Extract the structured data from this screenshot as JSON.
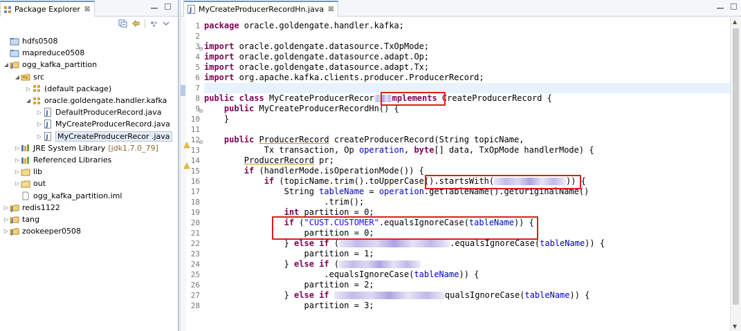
{
  "explorer": {
    "title": "Package Explorer",
    "close_glyph": "⊠",
    "tree": [
      {
        "label": "hdfs0508",
        "icon": "project-folder-icon",
        "level": 0,
        "twisty": ""
      },
      {
        "label": "mapreduce0508",
        "icon": "project-folder-icon",
        "level": 0,
        "twisty": ""
      },
      {
        "label": "ogg_kafka_partition",
        "icon": "java-project-icon",
        "level": 0,
        "twisty": "expanded"
      },
      {
        "label": "src",
        "icon": "source-folder-icon",
        "level": 1,
        "twisty": "expanded"
      },
      {
        "label": "(default package)",
        "icon": "package-icon",
        "level": 2,
        "twisty": "collapsed"
      },
      {
        "label": "oracle.goldengate.handler.kafka",
        "icon": "package-icon",
        "level": 2,
        "twisty": "expanded"
      },
      {
        "label": "DefaultProducerRecord.java",
        "icon": "java-file-icon",
        "level": 3,
        "twisty": "collapsed"
      },
      {
        "label": "MyCreateProducerRecord.java",
        "icon": "java-file-icon",
        "level": 3,
        "twisty": "collapsed"
      },
      {
        "label": "MyCreateProducerRecor    .java",
        "icon": "java-file-icon",
        "level": 3,
        "twisty": "collapsed",
        "selected": true
      },
      {
        "label": "JRE System Library",
        "version": "[jdk1.7.0_79]",
        "icon": "library-icon",
        "level": 1,
        "twisty": "collapsed"
      },
      {
        "label": "Referenced Libraries",
        "icon": "library-icon",
        "level": 1,
        "twisty": "collapsed"
      },
      {
        "label": "lib",
        "icon": "folder-icon",
        "level": 1,
        "twisty": "collapsed"
      },
      {
        "label": "out",
        "icon": "folder-icon",
        "level": 1,
        "twisty": "collapsed"
      },
      {
        "label": "ogg_kafka_partition.iml",
        "icon": "file-icon",
        "level": 1,
        "twisty": ""
      },
      {
        "label": "redis1122",
        "icon": "java-project-icon",
        "level": 0,
        "twisty": "collapsed"
      },
      {
        "label": "tang",
        "icon": "java-project-icon",
        "level": 0,
        "twisty": "collapsed"
      },
      {
        "label": "zookeeper0508",
        "icon": "java-project-icon",
        "level": 0,
        "twisty": "collapsed"
      }
    ]
  },
  "editor": {
    "tab_label": "MyCreateProducerRecordHn.java",
    "close_glyph": "⊠",
    "line_numbers": [
      "1",
      "2",
      "3",
      "4",
      "5",
      "6",
      "7",
      "8",
      "9",
      "10",
      "11",
      "12",
      "13",
      "14",
      "15",
      "16",
      "17",
      "18",
      "19",
      "20",
      "21",
      "22",
      "23",
      "24",
      "25",
      "26",
      "27",
      "28"
    ],
    "code": {
      "l1_kw": "package",
      "l1_rest": " oracle.goldengate.handler.kafka;",
      "l3_kw": "import",
      "l3_rest": " oracle.goldengate.datasource.TxOpMode;",
      "l4_kw": "import",
      "l4_rest": " oracle.goldengate.datasource.adapt.Op;",
      "l5_kw": "import",
      "l5_rest": " oracle.goldengate.datasource.adapt.Tx;",
      "l6_kw": "import",
      "l6_rest": " org.apache.kafka.clients.producer.ProducerRecord;",
      "l8_kw1": "public",
      "l8_kw2": "class",
      "l8_name": " MyCreateProducerRecor",
      "l8_impl": "mplements",
      "l8_tail": " CreateProducerRecord {",
      "l9_kw": "public",
      "l9_rest": " MyCreateProducerRecordHn() {",
      "l10": "    }",
      "l12_kw": "public",
      "l12_type": "ProducerRecord",
      "l12_rest": " createProducerRecord(String topicName,",
      "l13_a": "            Tx transaction, Op ",
      "l13_op": "operation",
      "l13_b": ", ",
      "l13_byte": "byte",
      "l13_c": "[] data, TxOpMode handlerMode) {",
      "l14_type": "ProducerRecord",
      "l14_rest": " pr;",
      "l15_kw": "if",
      "l15_rest": " (handlerMode.isOperationMode()) {",
      "l16_kw": "if",
      "l16_rest": " (topicName.trim().toUpperCase()",
      "l16_sw": ".startsWith(",
      "l16_tail": ")) {",
      "l17_a": "String ",
      "l17_tn": "tableName",
      "l17_b": " = ",
      "l17_op": "operation",
      "l17_c": ".getTableName().getOriginalName()",
      "l18": ".trim();",
      "l19_kw": "int",
      "l19_rest": " partition = 0;",
      "l20_kw": "if",
      "l20_a": " (",
      "l20_str": "\"CUST.CUSTOMER\"",
      "l20_b": ".equalsIgnoreCase(",
      "l20_tn": "tableName",
      "l20_c": ")) {",
      "l21": "partition = 0;",
      "l22_a": "} ",
      "l22_else": "else",
      "l22_if": "if",
      "l22_b": " (",
      "l22_c": ".equalsIgnoreCase(",
      "l22_tn": "tableName",
      "l22_d": ")) {",
      "l23": "partition = 1;",
      "l24_a": "} ",
      "l24_else": "else",
      "l24_if": "if",
      "l24_b": " (",
      "l25_a": ".equalsIgnoreCase(",
      "l25_tn": "tableName",
      "l25_b": ")) {",
      "l26": "partition = 2;",
      "l27_a": "} ",
      "l27_else": "else",
      "l27_if": "if",
      "l27_c": "qualsIgnoreCase(",
      "l27_tn": "tableName",
      "l27_d": ")) {",
      "l28": "partition = 3;"
    }
  },
  "colors": {
    "keyword": "#7f0055",
    "string": "#2a00ff",
    "highlight_box": "#e01b1b",
    "current_line": "#e8f2fe"
  }
}
